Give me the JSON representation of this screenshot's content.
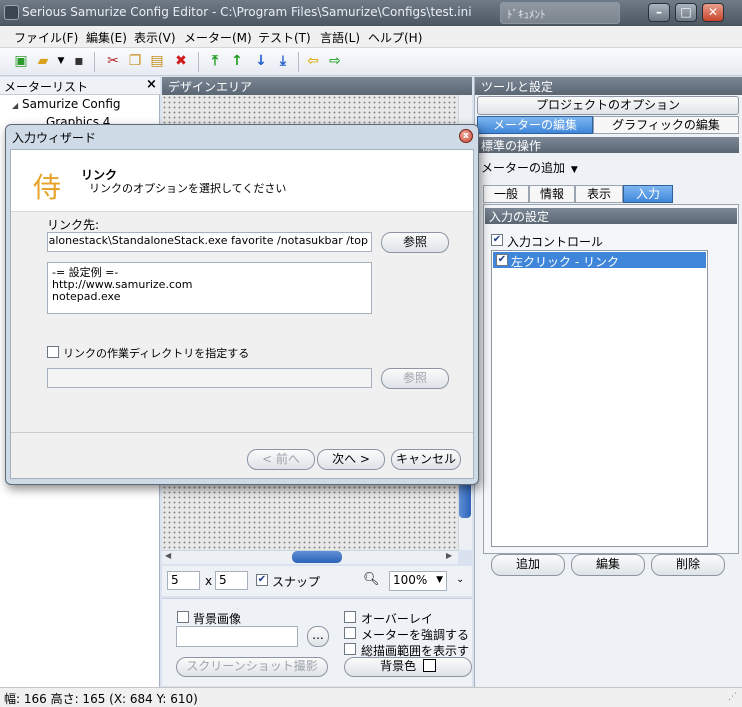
{
  "window": {
    "title": "Serious Samurize Config Editor - C:\\Program Files\\Samurize\\Configs\\test.ini",
    "background_window": "ﾄﾞｷｭﾒﾝﾄ"
  },
  "menu": [
    "ファイル(F)",
    "編集(E)",
    "表示(V)",
    "メーター(M)",
    "テスト(T)",
    "言語(L)",
    "ヘルプ(H)"
  ],
  "left_panel": {
    "title": "メーターリスト",
    "close": "×",
    "tree": [
      {
        "label": "Samurize Config",
        "toggle": "◢"
      },
      {
        "label": "Graphics 4"
      }
    ]
  },
  "design": {
    "title": "デザインエリア",
    "grid_x": "5",
    "grid_sep": "x",
    "grid_y": "5",
    "snap_label": "スナップ",
    "zoom": "100%",
    "bg_image_label": "背景画像",
    "browse_dots": "...",
    "screenshot_button": "スクリーンショット撮影",
    "overlay_label": "オーバーレイ",
    "highlight_label": "メーターを強調する",
    "draw_range_label": "総描画範囲を表示す",
    "bg_color_label": "背景色"
  },
  "right_panel": {
    "title": "ツールと設定",
    "project_options": "プロジェクトのオプション",
    "tabs": [
      "メーターの編集",
      "グラフィックの編集"
    ],
    "std_ops_title": "標準の操作",
    "add_meter": "メーターの追加",
    "add_meter_arrow": "▼",
    "subtabs": [
      "一般",
      "情報",
      "表示",
      "入力"
    ],
    "input_settings_title": "入力の設定",
    "input_control_label": "入力コントロール",
    "list_items": [
      "左クリック - リンク"
    ],
    "buttons": [
      "追加",
      "編集",
      "削除"
    ]
  },
  "status": "幅: 166  高さ: 165  (X: 684  Y: 610)",
  "dialog": {
    "title": "入力ウィザード",
    "close": "x",
    "logo": "侍",
    "heading": "リンク",
    "subheading": "リンクのオプションを選択してください",
    "link_label": "リンク先:",
    "link_value": "\\standalonestack\\StandaloneStack.exe favorite /notasukbar /top",
    "browse": "参照",
    "example_lines": [
      "-= 設定例 =-",
      "http://www.samurize.com",
      "notepad.exe"
    ],
    "workdir_label": "リンクの作業ディレクトリを指定する",
    "workdir_value": "",
    "browse2": "参照",
    "back": "< 前へ",
    "next": "次へ >",
    "cancel": "キャンセル"
  },
  "colors": {
    "accent": "#3f86da",
    "title_bar": "#5b6673",
    "selection": "#3f86da"
  }
}
